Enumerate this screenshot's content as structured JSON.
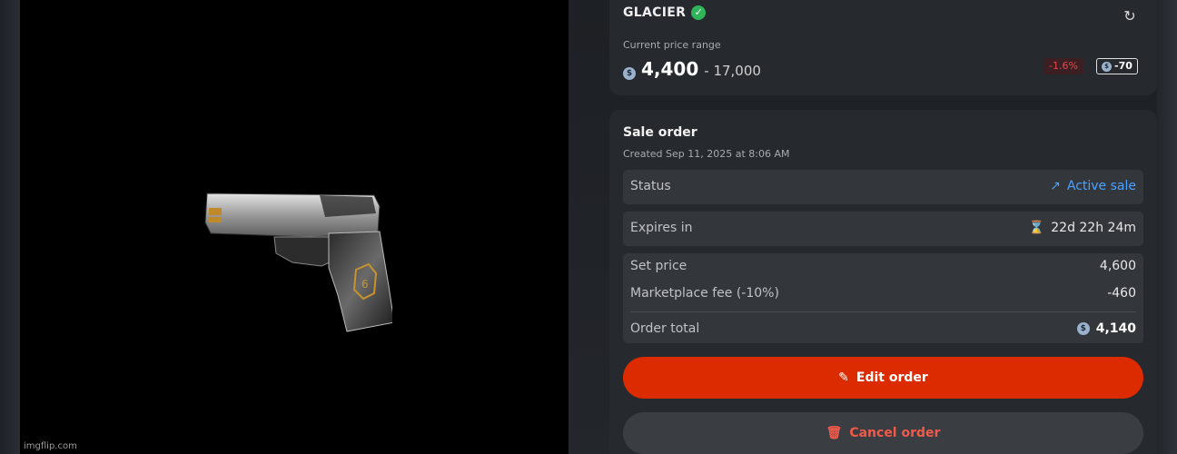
{
  "item": {
    "name": "GLACIER",
    "price_label": "Current price range",
    "price_min": "4,400",
    "price_max": "- 17,000",
    "change_percent": "-1.6%",
    "change_coins": "-70"
  },
  "sale_order": {
    "title": "Sale order",
    "created": "Created Sep 11, 2025 at 8:06 AM",
    "status_label": "Status",
    "status_value": "Active sale",
    "expires_label": "Expires in",
    "expires_value": "22d 22h 24m",
    "set_price_label": "Set price",
    "set_price_value": "4,600",
    "fee_label": "Marketplace fee (-10%)",
    "fee_value": "-460",
    "total_label": "Order total",
    "total_value": "4,140"
  },
  "actions": {
    "edit_label": "Edit order",
    "cancel_label": "Cancel order"
  },
  "icons": {
    "verified": "check-circle-icon",
    "refresh": "refresh-icon",
    "coin": "coin-icon",
    "arrow": "arrow-up-right-icon",
    "hourglass": "hourglass-icon",
    "pencil": "pencil-icon",
    "trash": "trash-icon"
  },
  "colors": {
    "accent_edit": "#dd2b00",
    "active_link": "#4aa3ff",
    "verified_green": "#2fb45a",
    "negative_red": "#e5484d"
  },
  "watermark": "imgflip.com"
}
